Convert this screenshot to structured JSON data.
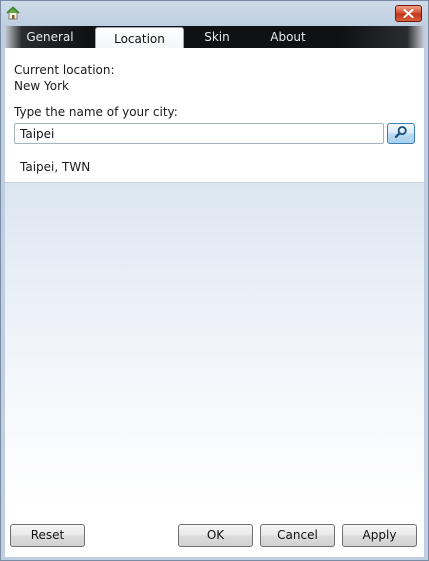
{
  "window": {
    "app_icon": "home-icon",
    "close_icon": "close-icon"
  },
  "tabs": [
    {
      "label": "General",
      "active": false
    },
    {
      "label": "Location",
      "active": true
    },
    {
      "label": "Skin",
      "active": false
    },
    {
      "label": "About",
      "active": false
    }
  ],
  "location": {
    "current_label": "Current location:",
    "current_value": "New York",
    "prompt_label": "Type the name of your city:",
    "search_value": "Taipei",
    "search_icon": "search-icon",
    "results": [
      "Taipei, TWN"
    ]
  },
  "buttons": {
    "reset": "Reset",
    "ok": "OK",
    "cancel": "Cancel",
    "apply": "Apply"
  },
  "colors": {
    "close_button": "#d34a2d",
    "tab_strip": "#101113",
    "search_button_border": "#3c7fb1"
  }
}
